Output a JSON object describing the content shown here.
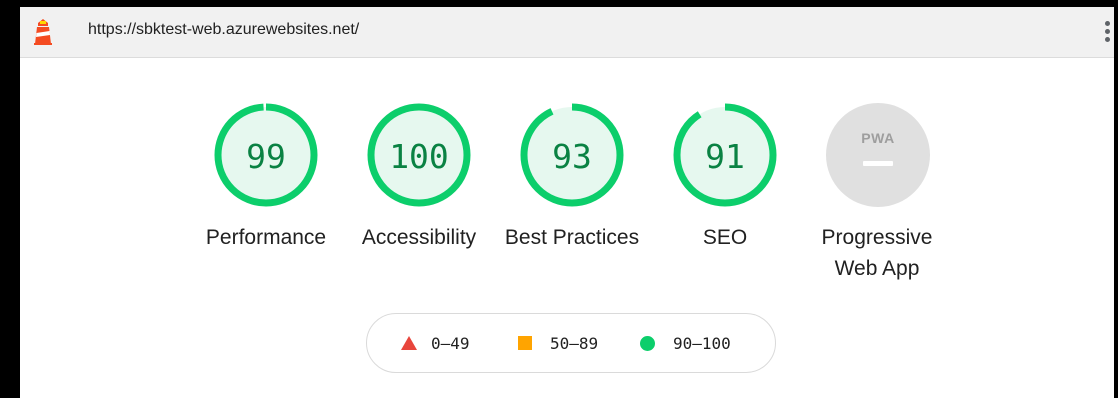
{
  "topbar": {
    "url": "https://sbktest-web.azurewebsites.net/",
    "logo_icon": "lighthouse-icon",
    "menu_icon": "more-vert-icon"
  },
  "gauges": [
    {
      "label": "Performance",
      "score": 99
    },
    {
      "label": "Accessibility",
      "score": 100
    },
    {
      "label": "Best Practices",
      "score": 93
    },
    {
      "label": "SEO",
      "score": 91
    }
  ],
  "pwa": {
    "badge_text": "PWA",
    "label": "Progressive Web App"
  },
  "legend": [
    {
      "range": "0–49",
      "icon": "fail-triangle-icon",
      "color": "#e8453c"
    },
    {
      "range": "50–89",
      "icon": "average-square-icon",
      "color": "#ffa400"
    },
    {
      "range": "90–100",
      "icon": "pass-circle-icon",
      "color": "#0cce6b"
    }
  ],
  "colors": {
    "pass_ring": "#0cce6b",
    "pass_fill": "#e6f8ef",
    "pass_text": "#0a8243",
    "pwa_gray": "#e0e0e0"
  }
}
